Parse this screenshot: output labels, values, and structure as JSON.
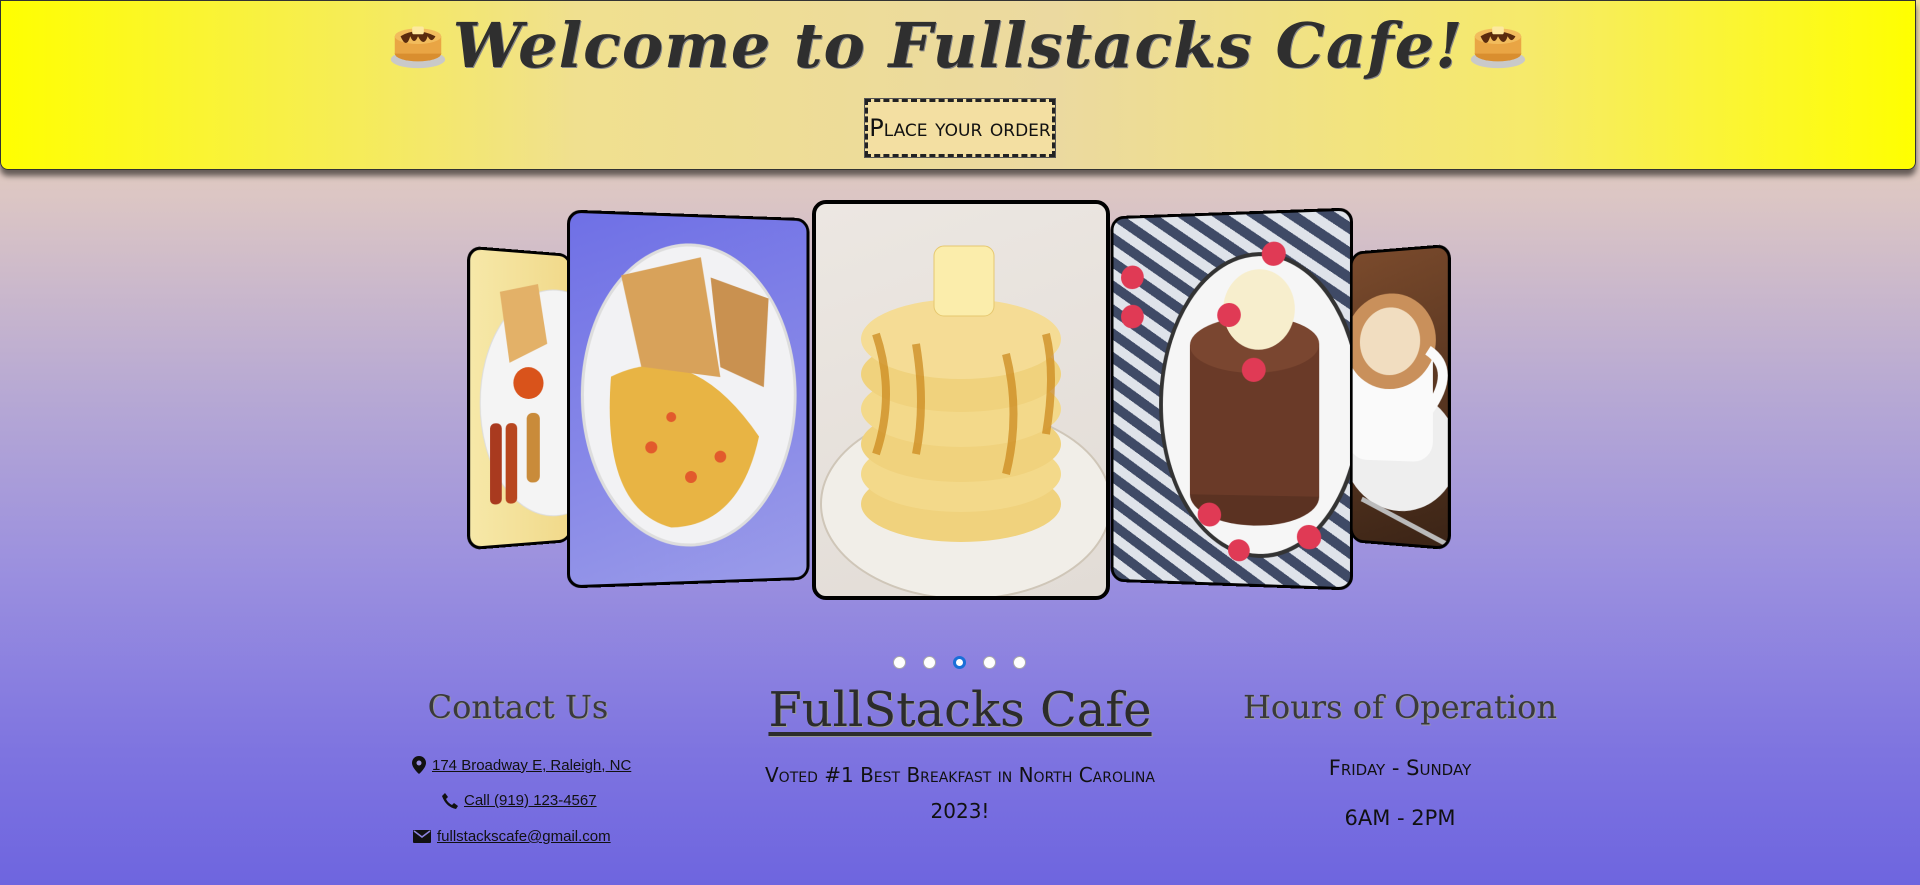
{
  "header": {
    "title": "Welcome to Fullstacks Cafe!",
    "order_button": "Place your order"
  },
  "carousel": {
    "slides": [
      "breakfast-plate",
      "omelette",
      "pancakes",
      "chocolate-pancakes",
      "latte"
    ],
    "active_index": 2,
    "dot_count": 5
  },
  "contact": {
    "title": "Contact Us",
    "address": "174 Broadway E, Raleigh, NC",
    "phone": "Call (919) 123-4567",
    "email": "fullstackscafe@gmail.com"
  },
  "brand": {
    "name": "FullStacks Cafe",
    "tagline_line1": "Voted #1 Best Breakfast in North Carolina",
    "tagline_line2": "2023!"
  },
  "hours": {
    "title": "Hours of Operation",
    "days": "Friday - Sunday",
    "time": "6AM - 2PM"
  },
  "colors": {
    "header_yellow": "#ffff00",
    "dot_active": "#1a6fd8"
  }
}
